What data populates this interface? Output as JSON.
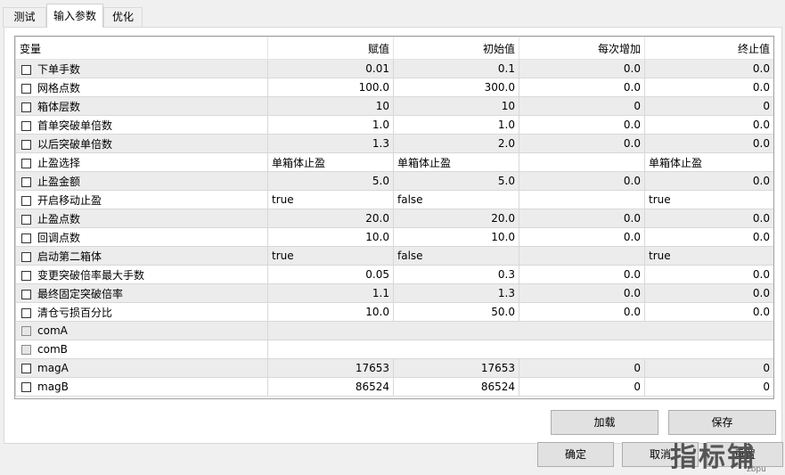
{
  "tabs": [
    {
      "label": "测试"
    },
    {
      "label": "输入参数"
    },
    {
      "label": "优化"
    }
  ],
  "table": {
    "headers": {
      "variable": "变量",
      "value": "赋值",
      "start": "初始值",
      "step": "每次增加",
      "stop": "终止值"
    },
    "rows": [
      {
        "name": "下单手数",
        "value": "0.01",
        "start": "0.1",
        "step": "0.0",
        "stop": "0.0"
      },
      {
        "name": "网格点数",
        "value": "100.0",
        "start": "300.0",
        "step": "0.0",
        "stop": "0.0"
      },
      {
        "name": "箱体层数",
        "value": "10",
        "start": "10",
        "step": "0",
        "stop": "0"
      },
      {
        "name": "首单突破单倍数",
        "value": "1.0",
        "start": "1.0",
        "step": "0.0",
        "stop": "0.0"
      },
      {
        "name": "以后突破单倍数",
        "value": "1.3",
        "start": "2.0",
        "step": "0.0",
        "stop": "0.0"
      },
      {
        "name": "止盈选择",
        "value": "单箱体止盈",
        "start": "单箱体止盈",
        "step": "",
        "stop": "单箱体止盈"
      },
      {
        "name": "止盈金额",
        "value": "5.0",
        "start": "5.0",
        "step": "0.0",
        "stop": "0.0"
      },
      {
        "name": "开启移动止盈",
        "value": "true",
        "start": "false",
        "step": "",
        "stop": "true"
      },
      {
        "name": "止盈点数",
        "value": "20.0",
        "start": "20.0",
        "step": "0.0",
        "stop": "0.0"
      },
      {
        "name": "回调点数",
        "value": "10.0",
        "start": "10.0",
        "step": "0.0",
        "stop": "0.0"
      },
      {
        "name": "启动第二箱体",
        "value": "true",
        "start": "false",
        "step": "",
        "stop": "true"
      },
      {
        "name": "变更突破倍率最大手数",
        "value": "0.05",
        "start": "0.3",
        "step": "0.0",
        "stop": "0.0"
      },
      {
        "name": "最终固定突破倍率",
        "value": "1.1",
        "start": "1.3",
        "step": "0.0",
        "stop": "0.0"
      },
      {
        "name": "清仓亏损百分比",
        "value": "10.0",
        "start": "50.0",
        "step": "0.0",
        "stop": "0.0"
      },
      {
        "name": "comA",
        "value": "",
        "start": "",
        "step": "",
        "stop": ""
      },
      {
        "name": "comB",
        "value": "",
        "start": "",
        "step": "",
        "stop": ""
      },
      {
        "name": "magA",
        "value": "17653",
        "start": "17653",
        "step": "0",
        "stop": "0"
      },
      {
        "name": "magB",
        "value": "86524",
        "start": "86524",
        "step": "0",
        "stop": "0"
      }
    ]
  },
  "buttons": {
    "load": "加载",
    "save": "保存",
    "ok": "确定",
    "cancel": "取消",
    "reset": "重置"
  },
  "watermark": {
    "text": "指标铺",
    "small": "zbpu"
  }
}
